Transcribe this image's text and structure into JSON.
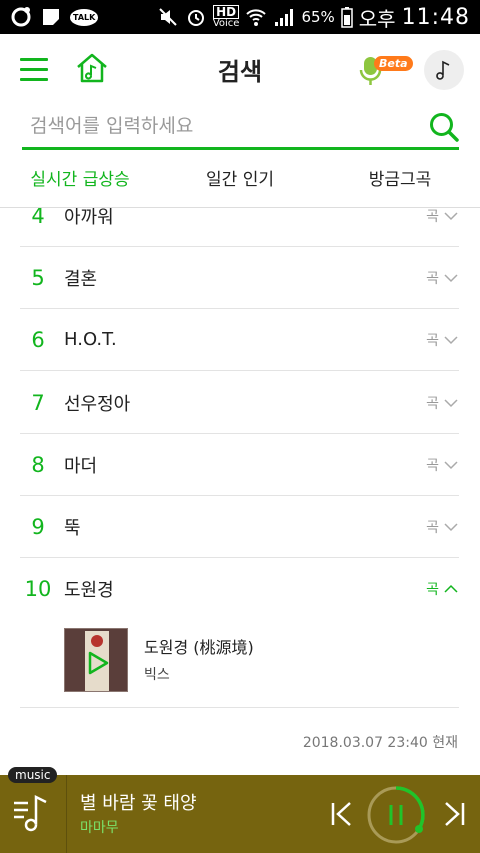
{
  "status_bar": {
    "talk": "TALK",
    "hd": "HD",
    "voice": "Voice",
    "battery": "65%",
    "ampm": "오후",
    "time": "11:48"
  },
  "app_bar": {
    "title": "검색",
    "beta": "Beta"
  },
  "search": {
    "placeholder": "검색어를 입력하세요"
  },
  "tabs": [
    {
      "label": "실시간 급상승",
      "active": true
    },
    {
      "label": "일간 인기",
      "active": false
    },
    {
      "label": "방금그곡",
      "active": false
    }
  ],
  "rows": [
    {
      "rank": "4",
      "keyword": "아까워",
      "type": "곡"
    },
    {
      "rank": "5",
      "keyword": "결혼",
      "type": "곡"
    },
    {
      "rank": "6",
      "keyword": "H.O.T.",
      "type": "곡"
    },
    {
      "rank": "7",
      "keyword": "선우정아",
      "type": "곡"
    },
    {
      "rank": "8",
      "keyword": "마더",
      "type": "곡"
    },
    {
      "rank": "9",
      "keyword": "뚝",
      "type": "곡"
    },
    {
      "rank": "10",
      "keyword": "도원경",
      "type": "곡"
    }
  ],
  "expanded": {
    "song_title": "도원경 (桃源境)",
    "artist": "빅스"
  },
  "timestamp": "2018.03.07 23:40 현재",
  "player": {
    "tag": "music",
    "title": "별 바람 꽃 태양",
    "artist": "마마무"
  },
  "colors": {
    "accent": "#12b51e",
    "player_bg": "#76640f",
    "beta": "#ff7a1a"
  }
}
